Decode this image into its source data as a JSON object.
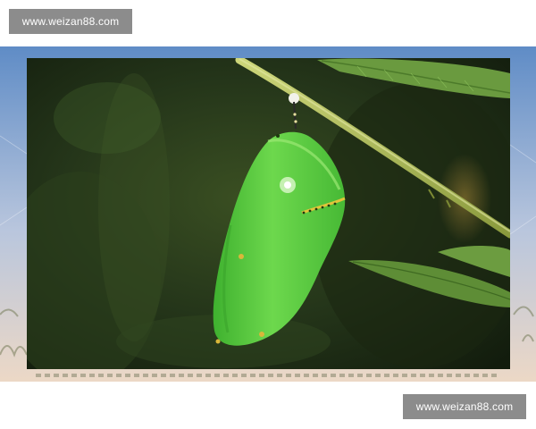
{
  "watermark": {
    "top_text": "www.weizan88.com",
    "bottom_text": "www.weizan88.com"
  },
  "photo": {
    "subject": "green-chrysalis-hanging-from-stem",
    "colors": {
      "frame_sky_top": "#6a93c8",
      "frame_sky_bottom": "#e9d7c7",
      "background_dark": "#1d2b12",
      "chrysalis_green": "#5fcf45",
      "chrysalis_light": "#8fe866",
      "stem": "#b5c463",
      "leaf": "#5d8a36"
    }
  }
}
